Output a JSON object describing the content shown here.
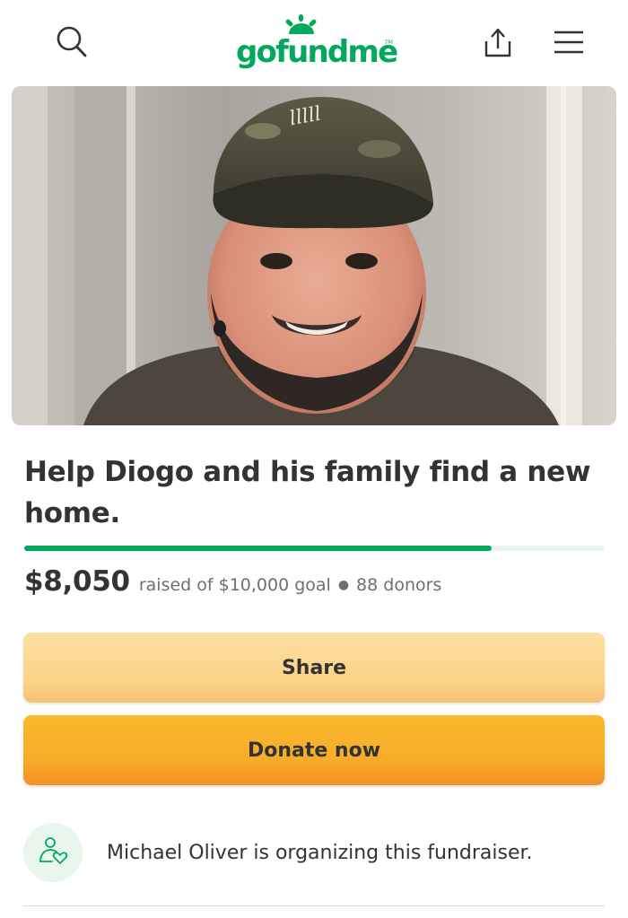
{
  "header": {
    "logo_text": "gofundme",
    "logo_tm": "TM",
    "icons": [
      "search-icon",
      "upload-share-icon",
      "hamburger-menu-icon"
    ],
    "brand_color": "#02a95c"
  },
  "campaign": {
    "title": "Help Diogo and his family find a new home.",
    "amount_raised": "$8,050",
    "raised_text": "raised of $10,000 goal",
    "donors_text": "88 donors",
    "progress_fraction": 0.805
  },
  "actions": {
    "share_label": "Share",
    "donate_label": "Donate now"
  },
  "organizer": {
    "text": "Michael Oliver is organizing this fundraiser."
  }
}
